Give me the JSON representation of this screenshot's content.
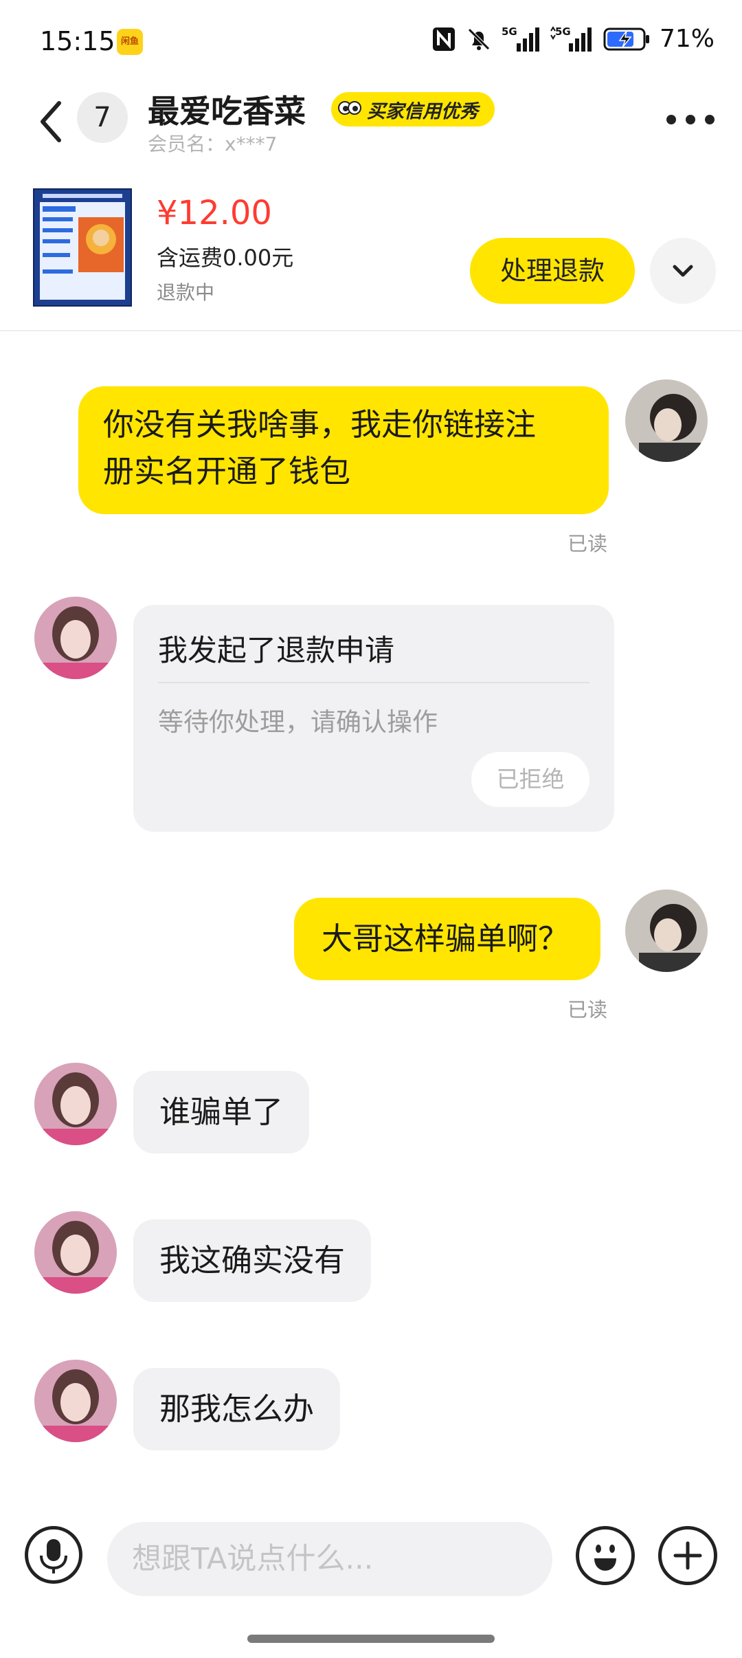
{
  "status_bar": {
    "time": "15:15",
    "app_badge": "闲鱼",
    "battery": "71%",
    "icons": [
      "nfc-icon",
      "bell-muted-icon",
      "5g-signal-icon",
      "5g-signal-icon",
      "battery-charging-icon"
    ]
  },
  "header": {
    "unread_count": "7",
    "nickname": "最爱吃香菜",
    "credit_badge": "买家信用优秀",
    "member": "会员名：x***7"
  },
  "product": {
    "price": "¥12.00",
    "shipping": "含运费0.00元",
    "status": "退款中",
    "action_button": "处理退款"
  },
  "messages": [
    {
      "from": "me",
      "text_lines": [
        "你没有关我啥事，我走你链接注",
        "册实名开通了钱包"
      ],
      "read": "已读"
    },
    {
      "from": "other",
      "type": "refund_card",
      "title": "我发起了退款申请",
      "subtitle": "等待你处理，请确认操作",
      "button": "已拒绝"
    },
    {
      "from": "me",
      "text": "大哥这样骗单啊？",
      "read": "已读"
    },
    {
      "from": "other",
      "text": "谁骗单了"
    },
    {
      "from": "other",
      "text": "我这确实没有"
    },
    {
      "from": "other",
      "text": "那我怎么办"
    }
  ],
  "input": {
    "placeholder": "想跟TA说点什么..."
  },
  "colors": {
    "accent_yellow": "#ffe500",
    "price_red": "#ff3b30",
    "bubble_gray": "#f1f1f3"
  }
}
